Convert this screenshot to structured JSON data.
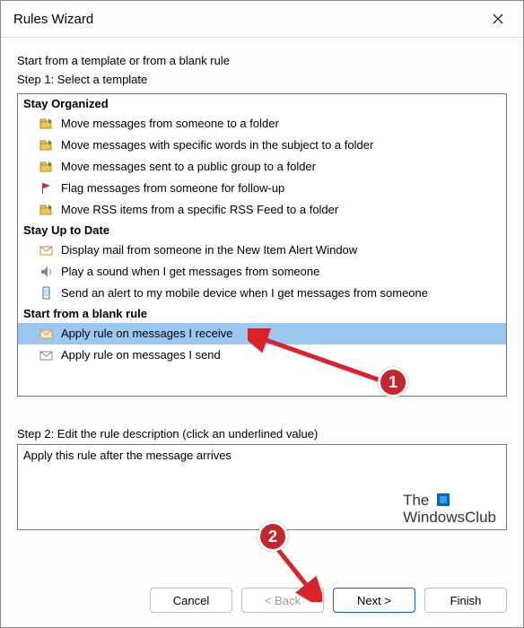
{
  "window": {
    "title": "Rules Wizard"
  },
  "intro": "Start from a template or from a blank rule",
  "step1_label": "Step 1: Select a template",
  "sections": {
    "stay_organized": {
      "header": "Stay Organized",
      "items": [
        "Move messages from someone to a folder",
        "Move messages with specific words in the subject to a folder",
        "Move messages sent to a public group to a folder",
        "Flag messages from someone for follow-up",
        "Move RSS items from a specific RSS Feed to a folder"
      ]
    },
    "stay_up_to_date": {
      "header": "Stay Up to Date",
      "items": [
        "Display mail from someone in the New Item Alert Window",
        "Play a sound when I get messages from someone",
        "Send an alert to my mobile device when I get messages from someone"
      ]
    },
    "blank_rule": {
      "header": "Start from a blank rule",
      "items": [
        "Apply rule on messages I receive",
        "Apply rule on messages I send"
      ]
    }
  },
  "step2_label": "Step 2: Edit the rule description (click an underlined value)",
  "description_text": "Apply this rule after the message arrives",
  "buttons": {
    "cancel": "Cancel",
    "back": "< Back",
    "next": "Next >",
    "finish": "Finish"
  },
  "watermark": {
    "line1": "The",
    "line2": "WindowsClub"
  },
  "annotations": {
    "badge1": "1",
    "badge2": "2"
  }
}
